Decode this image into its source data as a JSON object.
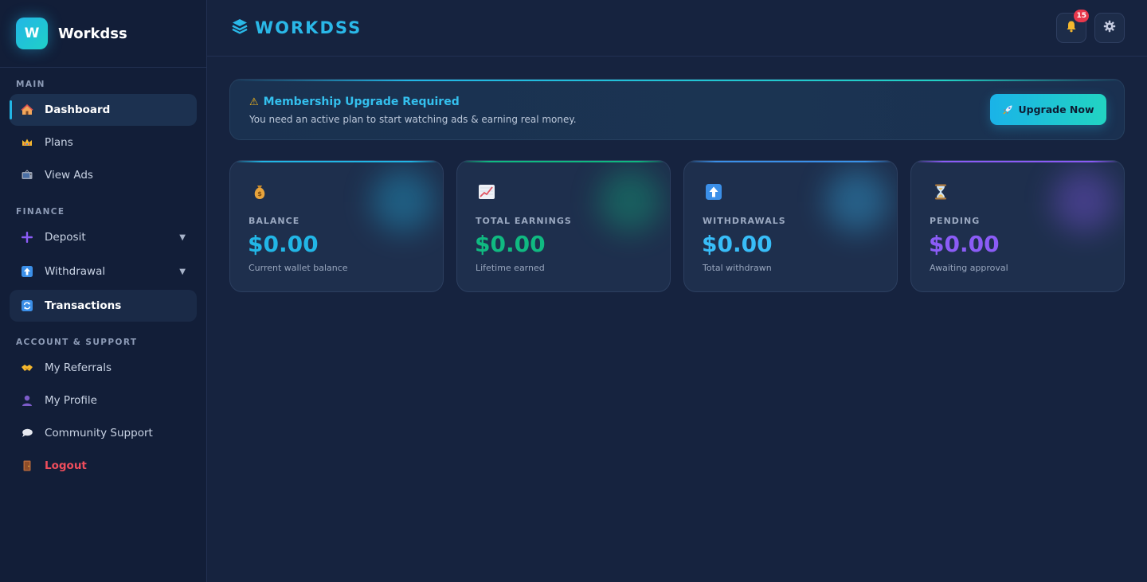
{
  "sidebar": {
    "brand_initial": "W",
    "brand_name": "Workdss",
    "sections": {
      "main": "MAIN",
      "finance": "FINANCE",
      "account": "ACCOUNT & SUPPORT"
    },
    "items": {
      "dashboard": {
        "label": "Dashboard",
        "icon": "house-icon"
      },
      "plans": {
        "label": "Plans",
        "icon": "crown-icon"
      },
      "view_ads": {
        "label": "View Ads",
        "icon": "tv-icon"
      },
      "deposit": {
        "label": "Deposit",
        "icon": "plus-icon"
      },
      "withdrawal": {
        "label": "Withdrawal",
        "icon": "up-arrow-icon"
      },
      "transactions": {
        "label": "Transactions",
        "icon": "refresh-icon"
      },
      "referrals": {
        "label": "My Referrals",
        "icon": "handshake-icon"
      },
      "profile": {
        "label": "My Profile",
        "icon": "user-icon"
      },
      "support": {
        "label": "Community Support",
        "icon": "speech-bubble-icon"
      },
      "logout": {
        "label": "Logout",
        "icon": "door-icon"
      }
    }
  },
  "topbar": {
    "brand_name": "WORKDSS",
    "notification_count": "15"
  },
  "alert": {
    "title": "Membership Upgrade Required",
    "text": "You need an active plan to start watching ads & earning real money.",
    "button_label": "Upgrade Now"
  },
  "cards": [
    {
      "label": "BALANCE",
      "value": "$0.00",
      "sub": "Current wallet balance",
      "icon": "money-bag-icon",
      "color": "#22b6e6"
    },
    {
      "label": "TOTAL EARNINGS",
      "value": "$0.00",
      "sub": "Lifetime earned",
      "icon": "chart-up-icon",
      "color": "#10b981"
    },
    {
      "label": "WITHDRAWALS",
      "value": "$0.00",
      "sub": "Total withdrawn",
      "icon": "up-arrow-icon",
      "color": "#38bdf8"
    },
    {
      "label": "PENDING",
      "value": "$0.00",
      "sub": "Awaiting approval",
      "icon": "hourglass-icon",
      "color": "#8b5cf6"
    }
  ],
  "colors": {
    "accent": "#22b6e6",
    "danger": "#ef4d5c",
    "background": "#16233f",
    "sidebar": "#121e38"
  }
}
